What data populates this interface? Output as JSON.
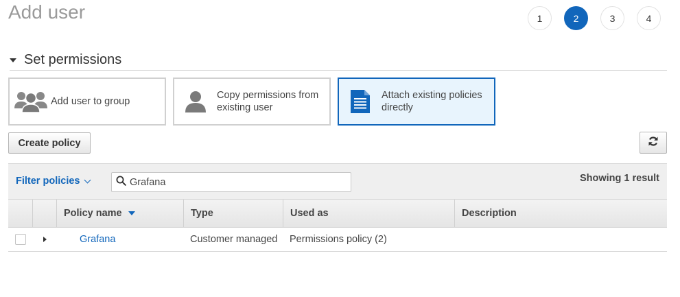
{
  "page": {
    "title": "Add user"
  },
  "steps": [
    "1",
    "2",
    "3",
    "4"
  ],
  "active_step": "2",
  "section": {
    "title": "Set permissions"
  },
  "options": [
    {
      "label": "Add user to group",
      "icon": "group-icon"
    },
    {
      "label": "Copy permissions from existing user",
      "icon": "user-icon"
    },
    {
      "label": "Attach existing policies directly",
      "icon": "document-icon",
      "selected": true
    }
  ],
  "toolbar": {
    "create_policy_label": "Create policy",
    "refresh_icon": "refresh-icon"
  },
  "filter": {
    "label": "Filter policies",
    "search_value": "Grafana",
    "result_text": "Showing 1 result"
  },
  "table": {
    "columns": [
      "Policy name",
      "Type",
      "Used as",
      "Description"
    ],
    "rows": [
      {
        "name": "Grafana",
        "type": "Customer managed",
        "used_as": "Permissions policy (2)",
        "description": ""
      }
    ]
  },
  "colors": {
    "accent": "#1166bb",
    "selected_bg": "#e8f4fd",
    "title_gray": "#9a9a9a"
  }
}
